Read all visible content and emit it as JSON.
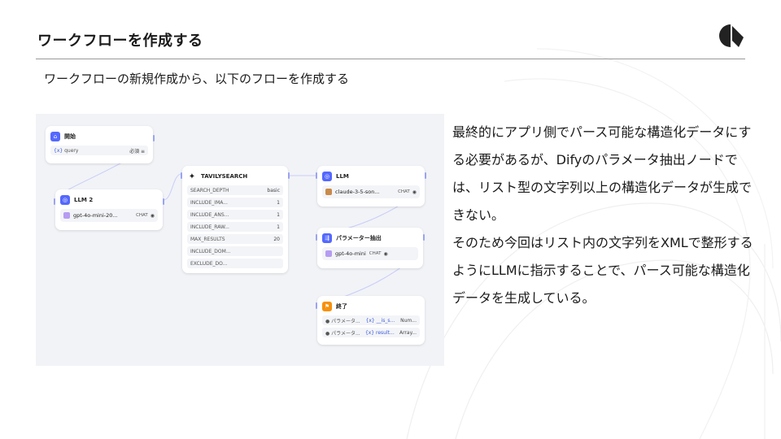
{
  "slide": {
    "title": "ワークフローを作成する",
    "subtitle": "ワークフローの新規作成から、以下のフローを作成する"
  },
  "description": {
    "paragraph1": "最終的にアプリ側でパース可能な構造化データにする必要があるが、Difyのパラメータ抽出ノードでは、リスト型の文字列以上の構造化データが生成できない。",
    "paragraph2": "そのため今回はリスト内の文字列をXMLで整形するようにLLMに指示することで、パース可能な構造化データを生成している。"
  },
  "workflow": {
    "start": {
      "title": "開始",
      "var_prefix": "{x}",
      "var_name": "query",
      "required": "必須 ≡"
    },
    "llm2": {
      "title": "LLM 2",
      "model": "gpt-4o-mini-20...",
      "mode": "CHAT"
    },
    "tavily": {
      "title": "TAVILYSEARCH",
      "params": [
        {
          "key": "SEARCH_DEPTH",
          "value": "basic"
        },
        {
          "key": "INCLUDE_IMA...",
          "value": "1"
        },
        {
          "key": "INCLUDE_ANS...",
          "value": "1"
        },
        {
          "key": "INCLUDE_RAW...",
          "value": "1"
        },
        {
          "key": "MAX_RESULTS",
          "value": "20"
        },
        {
          "key": "INCLUDE_DOM...",
          "value": ""
        },
        {
          "key": "EXCLUDE_DO...",
          "value": ""
        }
      ]
    },
    "llm": {
      "title": "LLM",
      "model": "claude-3-5-son...",
      "mode": "CHAT"
    },
    "param_extract": {
      "title": "パラメーター抽出",
      "model": "gpt-4o-mini",
      "mode": "CHAT"
    },
    "end": {
      "title": "終了",
      "outputs": [
        {
          "name": "パラメータ...",
          "var": "{x} __is_s...",
          "type": "Num..."
        },
        {
          "name": "パラメータ...",
          "var": "{x} result...",
          "type": "Array..."
        }
      ]
    }
  },
  "colors": {
    "node_icon_blue": "#5468ff",
    "node_icon_orange": "#f79009",
    "edge": "#b6bcf5"
  }
}
